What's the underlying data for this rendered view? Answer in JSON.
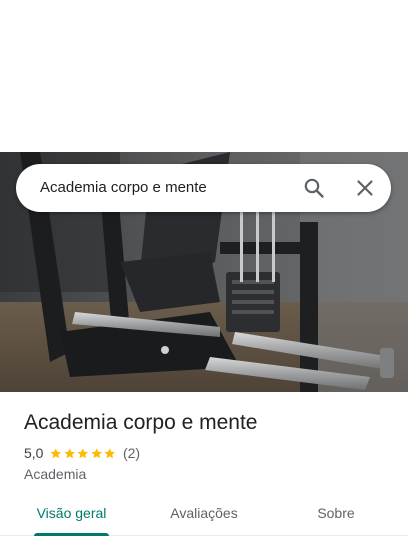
{
  "search": {
    "query": "Academia corpo e mente"
  },
  "place": {
    "name": "Academia corpo e mente",
    "rating": "5,0",
    "stars": 5,
    "review_count": "(2)",
    "category": "Academia"
  },
  "tabs": [
    {
      "label": "Visão geral",
      "active": true
    },
    {
      "label": "Avaliações",
      "active": false
    },
    {
      "label": "Sobre",
      "active": false
    }
  ],
  "colors": {
    "accent": "#00796b",
    "star": "#fbbc04",
    "text_primary": "#202124",
    "text_secondary": "#5f6368"
  },
  "icons": {
    "search": "search-icon",
    "close": "close-icon",
    "star": "star-icon"
  }
}
